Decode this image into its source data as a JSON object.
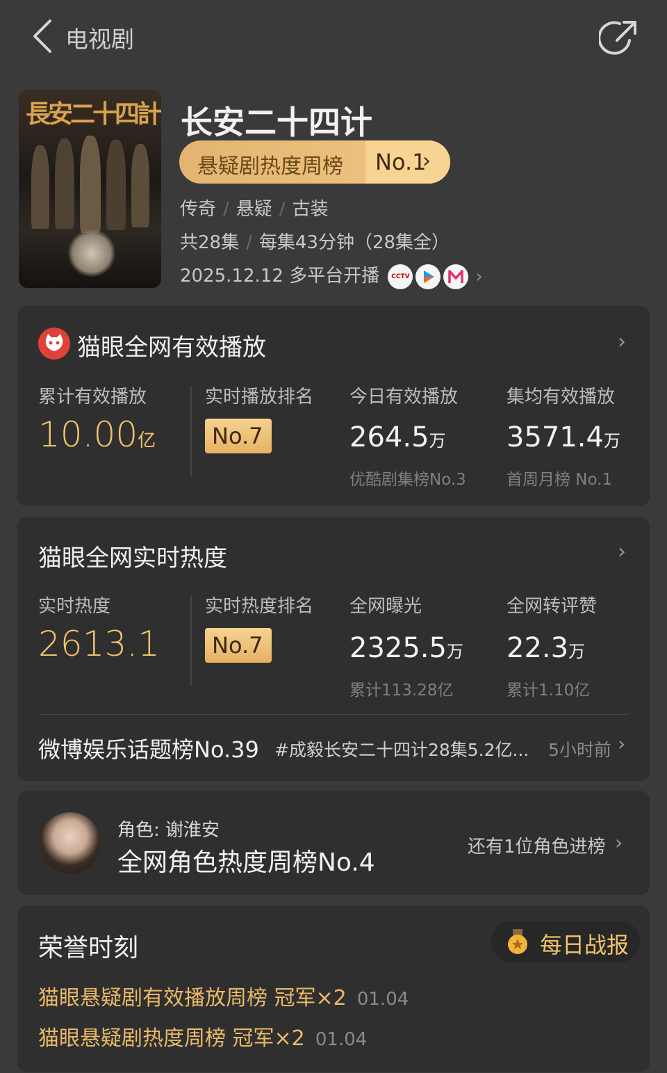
{
  "header": {
    "title": "电视剧"
  },
  "show": {
    "poster_text": "長安二十四計",
    "title": "长安二十四计",
    "rank_label": "悬疑剧热度周榜",
    "rank_no": "No.1",
    "genres": [
      "传奇",
      "悬疑",
      "古装"
    ],
    "episodes": "共28集",
    "duration": "每集43分钟（28集全）",
    "premiere": "2025.12.12 多平台开播",
    "platforms": [
      "CCTV8",
      "youku",
      "mgtv"
    ]
  },
  "playback": {
    "title": "猫眼全网有效播放",
    "stats": [
      {
        "label": "累计有效播放",
        "value": "10.00",
        "unit": "亿"
      },
      {
        "label": "实时播放排名",
        "value": "No.7"
      },
      {
        "label": "今日有效播放",
        "value": "264.5",
        "unit": "万",
        "sub": "优酷剧集榜No.3"
      },
      {
        "label": "集均有效播放",
        "value": "3571.4",
        "unit": "万",
        "sub": "首周月榜 No.1"
      }
    ]
  },
  "heat": {
    "title": "猫眼全网实时热度",
    "stats": [
      {
        "label": "实时热度",
        "value": "2613.1"
      },
      {
        "label": "实时热度排名",
        "value": "No.7"
      },
      {
        "label": "全网曝光",
        "value": "2325.5",
        "unit": "万",
        "sub": "累计113.28亿"
      },
      {
        "label": "全网转评赞",
        "value": "22.3",
        "unit": "万",
        "sub": "累计1.10亿"
      }
    ],
    "weibo": {
      "rank": "微博娱乐话题榜No.39",
      "tag": "#成毅长安二十四计28集5.2亿...",
      "time": "5小时前"
    }
  },
  "role": {
    "name": "角色: 谢淮安",
    "rank": "全网角色热度周榜No.4",
    "more": "还有1位角色进榜"
  },
  "honor": {
    "title": "荣誉时刻",
    "daily": "每日战报",
    "items": [
      {
        "text": "猫眼悬疑剧有效播放周榜 冠军×2",
        "date": "01.04"
      },
      {
        "text": "猫眼悬疑剧热度周榜 冠军×2",
        "date": "01.04"
      }
    ]
  }
}
